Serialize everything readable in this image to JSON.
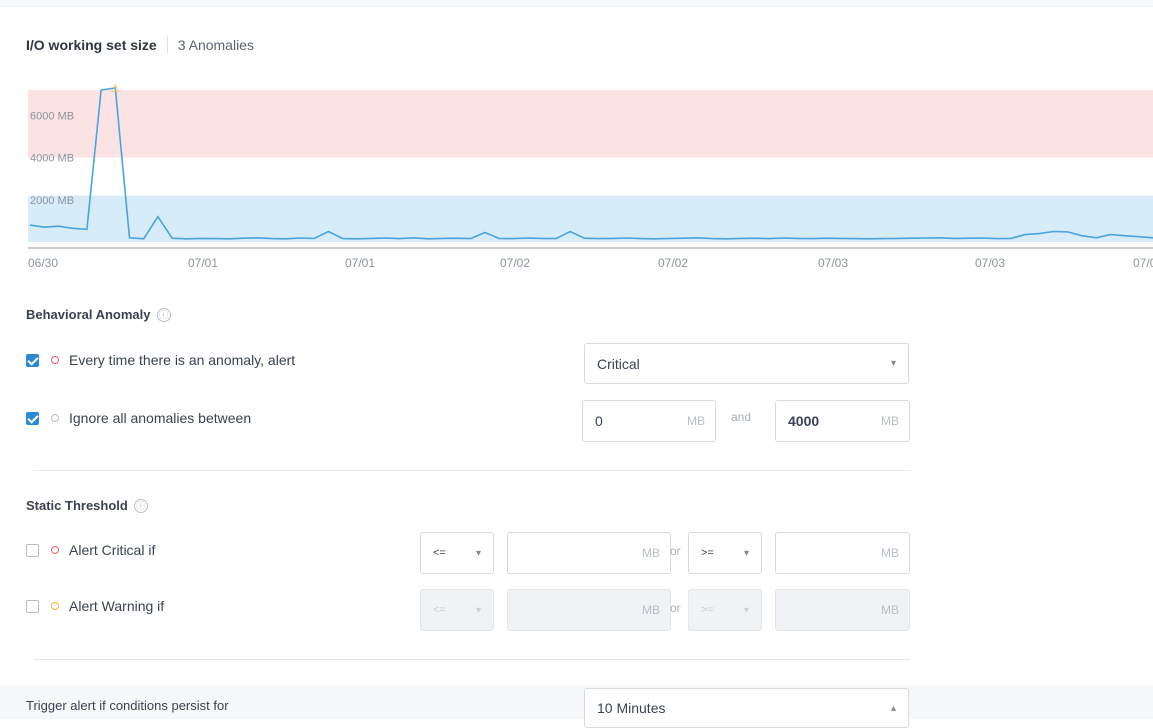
{
  "header": {
    "title": "I/O working set size",
    "anomalies": "3 Anomalies"
  },
  "chart_data": {
    "type": "line",
    "y_ticks": [
      "6000 MB",
      "4000 MB",
      "2000 MB"
    ],
    "x_ticks": [
      "06/30",
      "07/01",
      "07/01",
      "07/02",
      "07/02",
      "07/03",
      "07/03",
      "07/0"
    ],
    "alert_band_mb": [
      4000,
      7200
    ],
    "anomaly_marker": "⚠",
    "series": [
      {
        "values": [
          800,
          700,
          750,
          650,
          600,
          7200,
          7300,
          200,
          150,
          1200,
          180,
          150,
          170,
          160,
          150,
          180,
          200,
          160,
          150,
          190,
          170,
          500,
          160,
          150,
          170,
          190,
          160,
          200,
          150,
          170,
          180,
          160,
          450,
          170,
          160,
          190,
          170,
          160,
          500,
          180,
          160,
          170,
          190,
          160,
          150,
          170,
          180,
          200,
          160,
          150,
          170,
          180,
          160,
          190,
          170,
          160,
          180,
          170,
          160,
          150,
          160,
          170,
          180,
          190,
          200,
          170,
          180,
          190,
          160,
          170,
          350,
          400,
          500,
          480,
          300,
          200,
          350,
          300,
          250,
          200
        ]
      }
    ]
  },
  "behavioral": {
    "title": "Behavioral Anomaly",
    "info_icon": "ⓘ",
    "row1_label": "Every time there is an anomaly, alert",
    "row1_select": "Critical",
    "row2_label": "Ignore all anomalies between",
    "min_value": "0",
    "max_value": "4000",
    "unit": "MB",
    "and_label": "and"
  },
  "static": {
    "title": "Static Threshold",
    "info_icon": "ⓘ",
    "critical_label": "Alert Critical if",
    "warning_label": "Alert Warning if",
    "op_lte": "<=",
    "op_gte": ">=",
    "unit": "MB",
    "or_label": "or"
  },
  "trigger": {
    "label": "Trigger alert if conditions persist for",
    "value": "10 Minutes"
  },
  "icons": {
    "caret_down": "▾",
    "caret_up": "▴"
  },
  "colors": {
    "accent": "#2a8ad6",
    "critical": "#e2606a",
    "warning": "#f0b533",
    "line": "#4aa3df",
    "band_normal": "#d6ecf9",
    "band_alert": "#fbe3e3"
  }
}
